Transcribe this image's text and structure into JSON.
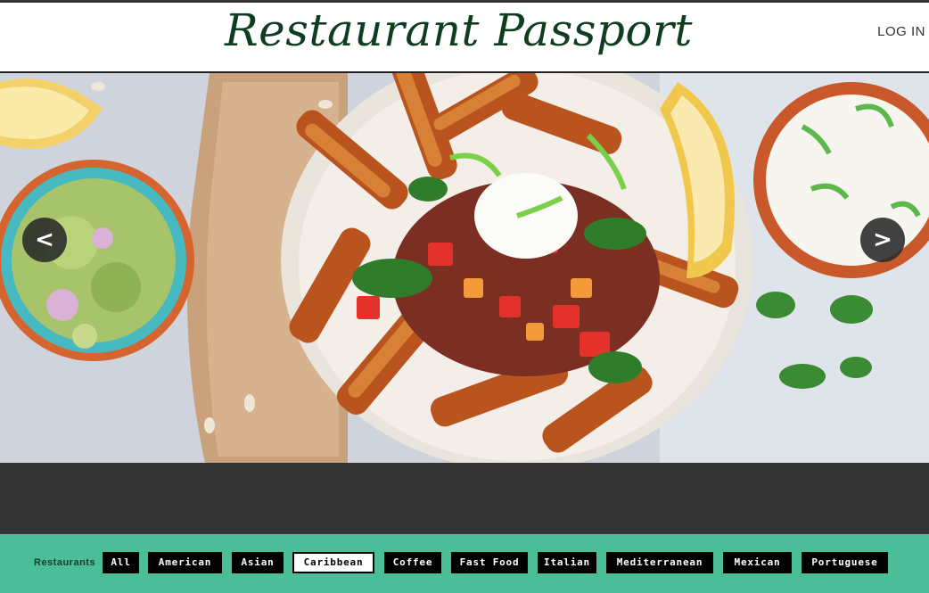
{
  "header": {
    "title": "Restaurant Passport",
    "login_label": "LOG IN"
  },
  "carousel": {
    "prev_label": "<",
    "next_label": ">",
    "image_description_icon": "food-photo"
  },
  "filters": {
    "label": "Restaurants",
    "items": [
      {
        "label": "All",
        "active": false
      },
      {
        "label": "American",
        "active": false
      },
      {
        "label": "Asian",
        "active": false
      },
      {
        "label": "Caribbean",
        "active": true
      },
      {
        "label": "Coffee",
        "active": false
      },
      {
        "label": "Fast Food",
        "active": false
      },
      {
        "label": "Italian",
        "active": false
      },
      {
        "label": "Mediterranean",
        "active": false
      },
      {
        "label": "Mexican",
        "active": false
      },
      {
        "label": "Portuguese",
        "active": false
      }
    ]
  },
  "colors": {
    "brand": "#0f3d20",
    "dark_band": "#333333",
    "filter_bar": "#4bbd99",
    "button_bg": "#000000",
    "button_text": "#ffffff"
  }
}
